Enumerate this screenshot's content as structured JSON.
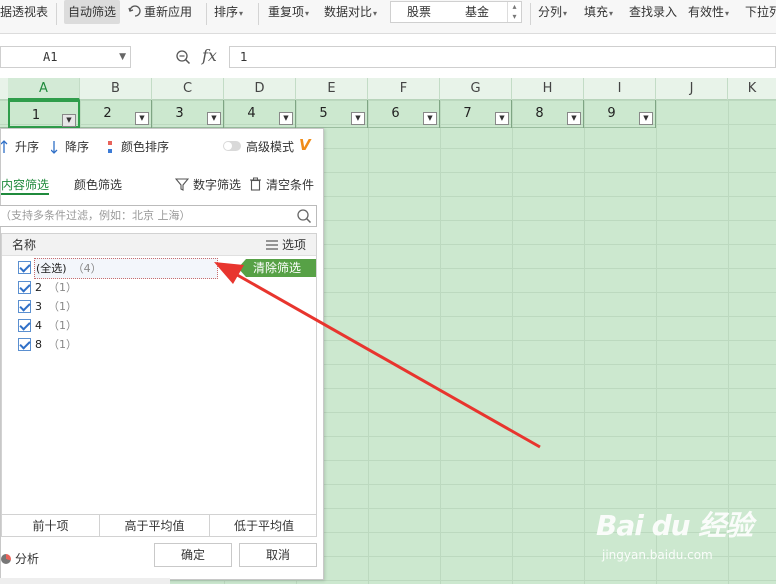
{
  "ribbon": {
    "items": [
      {
        "id": "pivot",
        "label": "数据透视表",
        "visible": "据透视表"
      },
      {
        "id": "autofilter",
        "label": "自动筛选"
      },
      {
        "id": "reapply",
        "label": "重新应用"
      },
      {
        "id": "sort",
        "label": "排序"
      },
      {
        "id": "dupes",
        "label": "重复项"
      },
      {
        "id": "compare",
        "label": "数据对比"
      },
      {
        "id": "split",
        "label": "分列"
      },
      {
        "id": "fill",
        "label": "填充"
      },
      {
        "id": "lookup",
        "label": "查找录入"
      },
      {
        "id": "validity",
        "label": "有效性"
      },
      {
        "id": "dropdown",
        "label": "下拉列表",
        "visible": "下拉列"
      }
    ],
    "stock": "股票",
    "fund": "基金"
  },
  "formula_bar": {
    "name_box": "A1",
    "fx": "fx",
    "value": "1"
  },
  "columns": [
    "A",
    "B",
    "C",
    "D",
    "E",
    "F",
    "G",
    "H",
    "I",
    "J",
    "K"
  ],
  "header_row": [
    "1",
    "2",
    "3",
    "4",
    "5",
    "6",
    "7",
    "8",
    "9"
  ],
  "filter_panel": {
    "sort_asc": "升序",
    "sort_desc": "降序",
    "sort_color": "颜色排序",
    "advanced_mode": "高级模式",
    "tab_content": "内容筛选",
    "tab_color": "颜色筛选",
    "number_filter": "数字筛选",
    "clear_conditions": "清空条件",
    "search_placeholder": "（支持多条件过滤，例如：北京 上海）",
    "list_header_name": "名称",
    "list_header_options": "选项",
    "select_all": "(全选)",
    "select_all_count": "（4）",
    "clear_filter": "清除筛选",
    "items": [
      {
        "label": "2",
        "count": "（1）"
      },
      {
        "label": "3",
        "count": "（1）"
      },
      {
        "label": "4",
        "count": "（1）"
      },
      {
        "label": "8",
        "count": "（1）"
      }
    ],
    "quick": [
      "前十项",
      "高于平均值",
      "低于平均值"
    ],
    "analysis": "分析",
    "ok": "确定",
    "cancel": "取消"
  },
  "watermark": {
    "logo": "Bai du 经验",
    "url": "jingyan.baidu.com"
  },
  "colors": {
    "grid_bg": "#cce8cf",
    "accent_green": "#1f8a3c",
    "clear_btn": "#57a146",
    "arrow": "#e8352e"
  }
}
